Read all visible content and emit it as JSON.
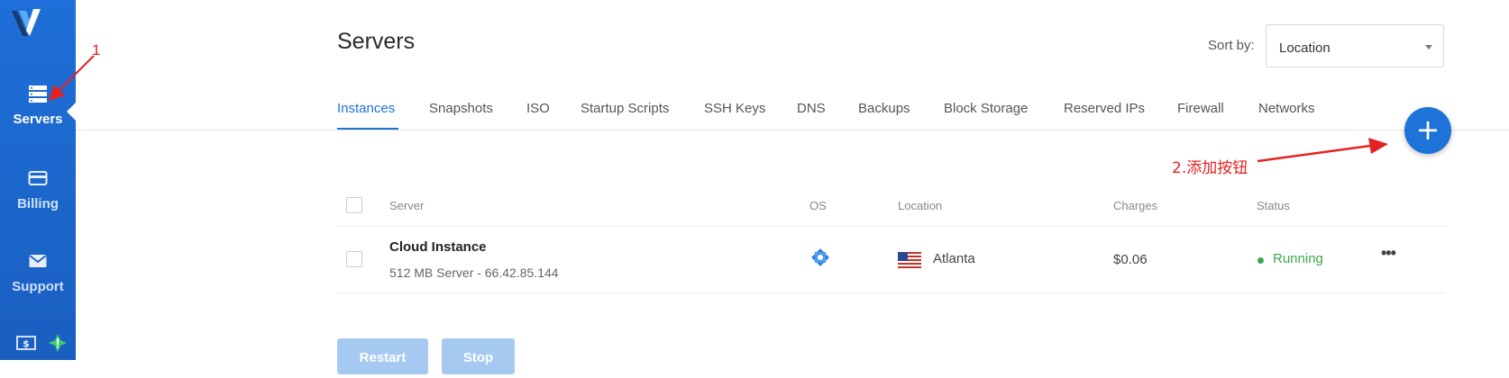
{
  "sidebar": {
    "items": [
      {
        "label": "Servers",
        "icon": "server-stack-icon"
      },
      {
        "label": "Billing",
        "icon": "credit-card-icon"
      },
      {
        "label": "Support",
        "icon": "envelope-icon"
      }
    ]
  },
  "header": {
    "title": "Servers",
    "sort_label": "Sort by:",
    "sort_value": "Location"
  },
  "tabs": [
    "Instances",
    "Snapshots",
    "ISO",
    "Startup Scripts",
    "SSH Keys",
    "DNS",
    "Backups",
    "Block Storage",
    "Reserved IPs",
    "Firewall",
    "Networks"
  ],
  "add_button": "+",
  "annotations": {
    "arrow_1": "1",
    "arrow_2": "2.添加按钮"
  },
  "table": {
    "headers": [
      "Server",
      "OS",
      "Location",
      "Charges",
      "Status"
    ],
    "rows": [
      {
        "name": "Cloud Instance",
        "sub": "512 MB Server - 66.42.85.144",
        "os_icon": "os-logo-icon",
        "location": "Atlanta",
        "charges": "$0.06",
        "status": "Running",
        "more": "•••"
      }
    ]
  },
  "actions": {
    "restart": "Restart",
    "stop": "Stop"
  },
  "colors": {
    "sidebar": "#1e6fd9",
    "accent": "#1e73d8",
    "running": "#3aa84b",
    "annotation": "#e52222"
  }
}
